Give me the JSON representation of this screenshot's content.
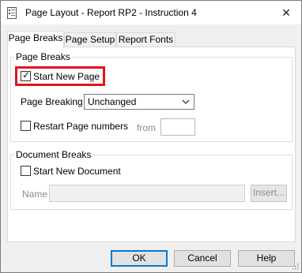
{
  "window": {
    "title": "Page Layout - Report RP2 - Instruction 4",
    "close_glyph": "✕"
  },
  "tabs": [
    {
      "label": "Page Breaks",
      "active": true
    },
    {
      "label": "Page Setup",
      "active": false
    },
    {
      "label": "Report Fonts",
      "active": false
    }
  ],
  "page_breaks_group": {
    "title": "Page Breaks",
    "start_new_page": {
      "label": "Start New Page",
      "checked": true
    },
    "page_breaking": {
      "label": "Page Breaking",
      "value": "Unchanged"
    },
    "restart_page_numbers": {
      "label": "Restart Page numbers",
      "checked": false
    },
    "from": {
      "label": "from",
      "value": ""
    }
  },
  "document_breaks_group": {
    "title": "Document Breaks",
    "start_new_document": {
      "label": "Start New Document",
      "checked": false
    },
    "name": {
      "label": "Name",
      "value": ""
    },
    "insert_button": "Insert..."
  },
  "buttons": {
    "ok": "OK",
    "cancel": "Cancel",
    "help": "Help"
  },
  "colors": {
    "highlight": "#e3151a",
    "default_button_border": "#0078d7"
  },
  "icons": {
    "title": "report-document-icon",
    "dropdown": "chevron-down-icon",
    "close": "close-icon",
    "checkmark": "check-icon",
    "resize": "resize-grip-icon"
  }
}
